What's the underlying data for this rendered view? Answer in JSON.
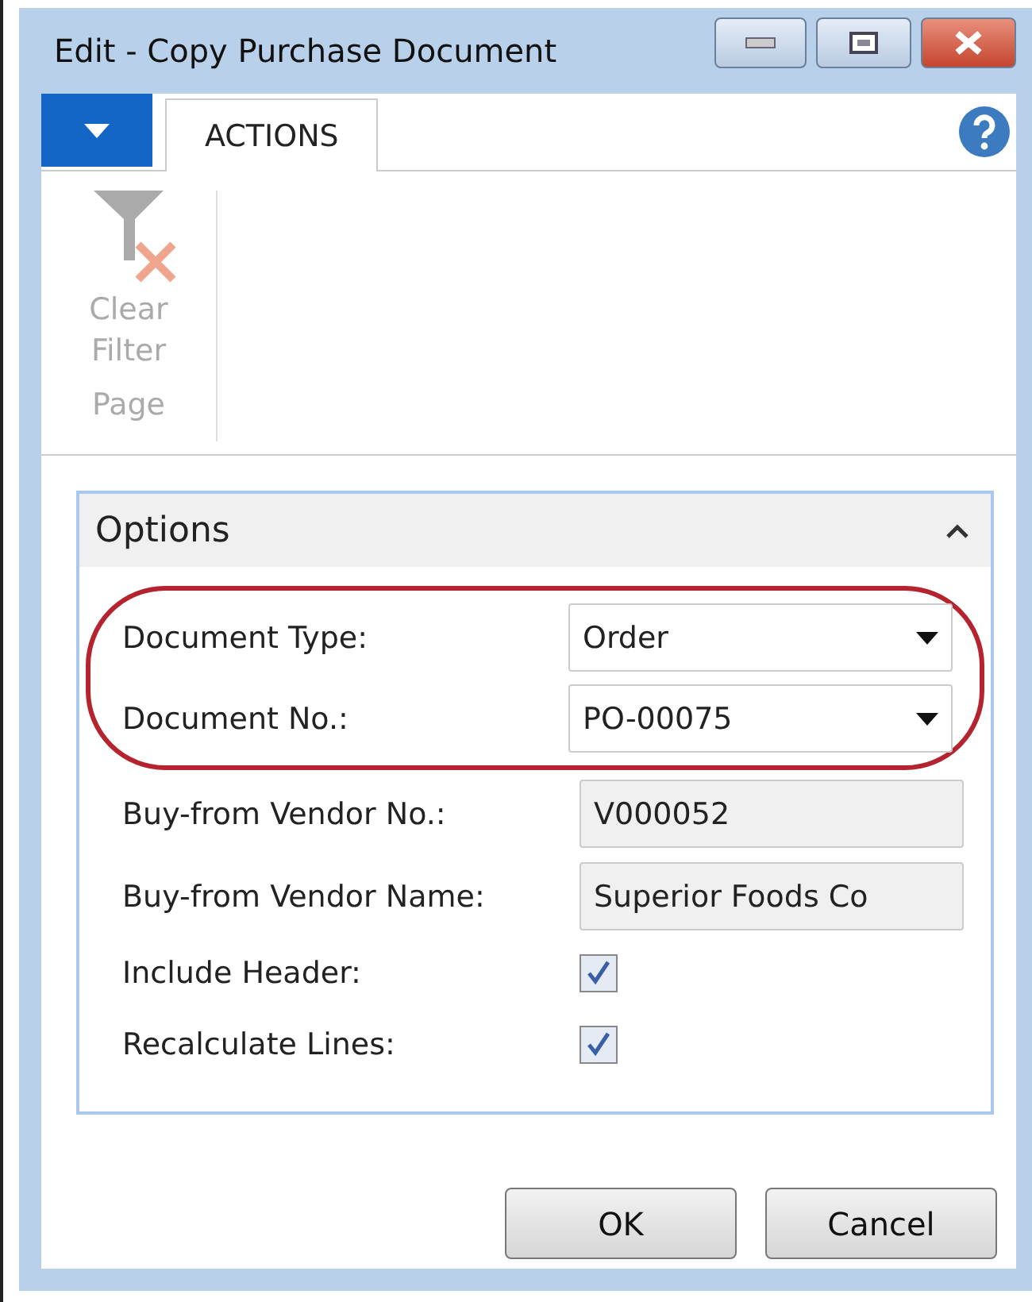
{
  "window": {
    "title": "Edit - Copy Purchase Document"
  },
  "ribbon": {
    "tabs": [
      {
        "label": "ACTIONS",
        "selected": true
      }
    ],
    "actions": [
      {
        "label": "Clear Filter",
        "disabled": true
      }
    ],
    "group": "Page"
  },
  "options": {
    "title": "Options",
    "expanded": true,
    "fields": [
      {
        "kind": "dropdown",
        "label": "Document Type:",
        "value": "Order",
        "highlighted": true
      },
      {
        "kind": "dropdown",
        "label": "Document No.:",
        "value": "PO-00075",
        "highlighted": true
      },
      {
        "kind": "readonly",
        "label": "Buy-from Vendor No.:",
        "value": "V000052",
        "highlighted": false
      },
      {
        "kind": "readonly",
        "label": "Buy-from Vendor Name:",
        "value": "Superior Foods Co",
        "highlighted": false
      },
      {
        "kind": "checkbox",
        "label": "Include Header:",
        "checked": true,
        "highlighted": false
      },
      {
        "kind": "checkbox",
        "label": "Recalculate Lines:",
        "checked": true,
        "highlighted": false
      }
    ]
  },
  "buttons": [
    "OK",
    "Cancel"
  ]
}
